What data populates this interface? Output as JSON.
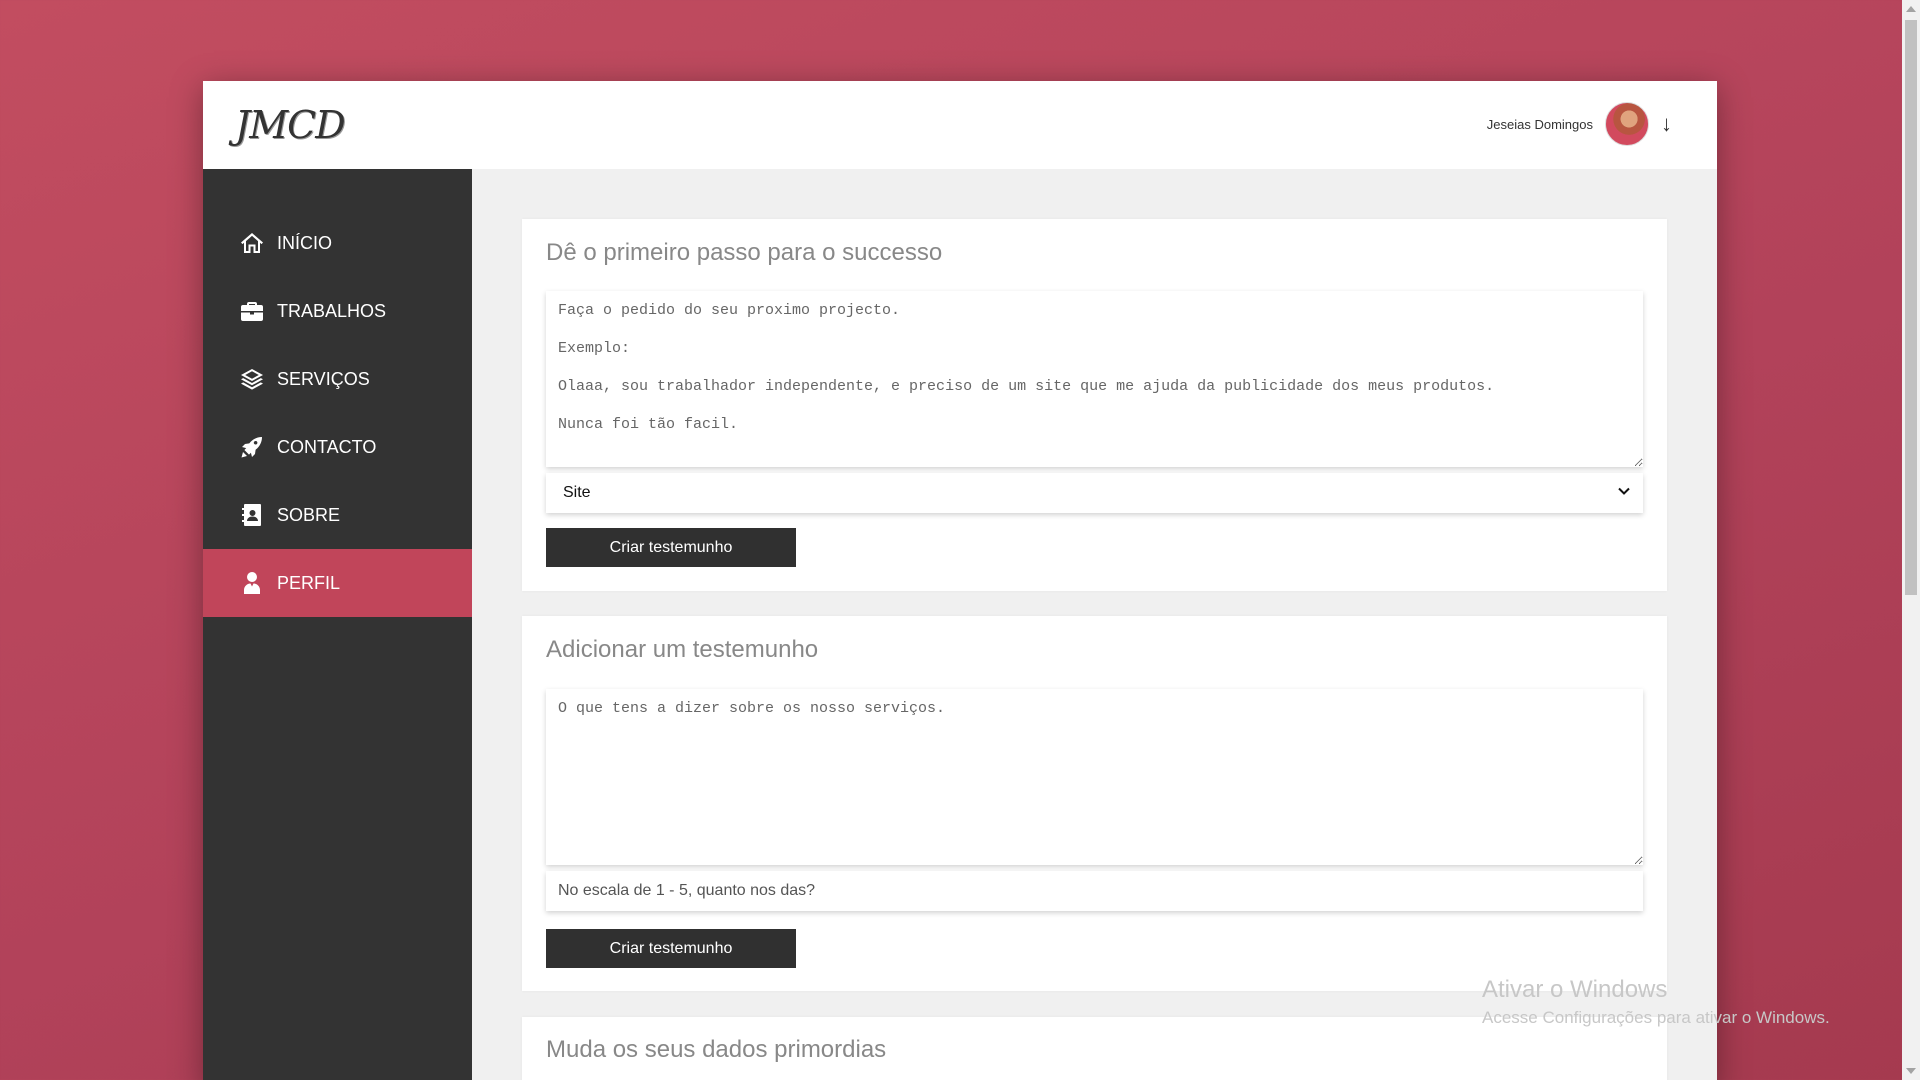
{
  "app": {
    "logo": "JMCD",
    "user_name": "Jeseias Domingos",
    "arrow": "↓"
  },
  "sidebar": {
    "items": [
      {
        "label": "INÍCIO",
        "icon": "home-icon"
      },
      {
        "label": "TRABALHOS",
        "icon": "briefcase-icon"
      },
      {
        "label": "SERVIÇOS",
        "icon": "layers-icon"
      },
      {
        "label": "CONTACTO",
        "icon": "rocket-icon"
      },
      {
        "label": "SOBRE",
        "icon": "address-book-icon"
      },
      {
        "label": "PERFIL",
        "icon": "user-icon",
        "active": true
      }
    ]
  },
  "cards": {
    "request": {
      "title": "Dê o primeiro passo para o successo",
      "placeholder": "Faça o pedido do seu proximo projecto.\n\nExemplo:\n\nOlaaa, sou trabalhador independente, e preciso de um site que me ajuda da publicidade dos meus produtos.\n\nNunca foi tão facil.",
      "select_value": "Site",
      "button": "Criar testemunho"
    },
    "testimonial": {
      "title": "Adicionar um testemunho",
      "placeholder": "O que tens a dizer sobre os nosso serviços.",
      "rating_placeholder": "No escala de 1 - 5, quanto nos das?",
      "button": "Criar testemunho"
    },
    "profile": {
      "title": "Muda os seus dados primordias"
    }
  },
  "watermark": {
    "title": "Ativar o Windows",
    "subtitle": "Acesse Configurações para ativar o Windows."
  },
  "colors": {
    "accent": "#c1455a",
    "sidebar": "#333333",
    "button": "#303030"
  }
}
